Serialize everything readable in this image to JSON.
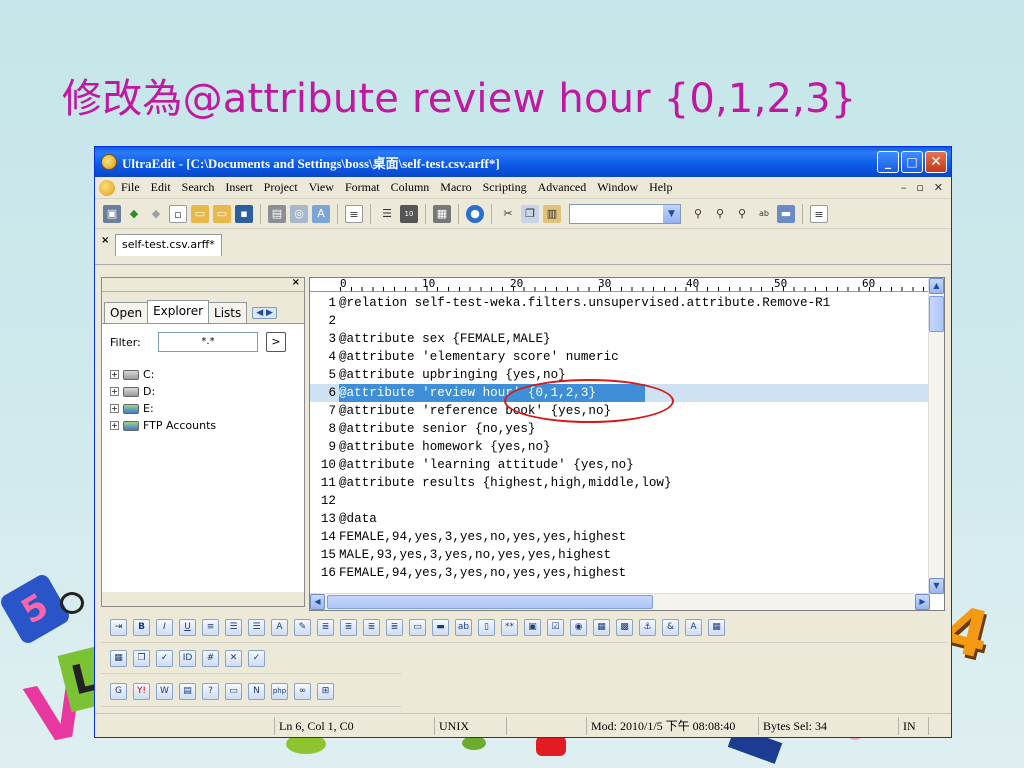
{
  "slide": {
    "title": "修改為@attribute review hour {0,1,2,3}"
  },
  "window": {
    "title": "UltraEdit - [C:\\Documents and Settings\\boss\\桌面\\self-test.csv.arff*]",
    "buttons": {
      "minimize": "_",
      "maximize": "□",
      "close": "✕"
    }
  },
  "menu": {
    "items": [
      "File",
      "Edit",
      "Search",
      "Insert",
      "Project",
      "View",
      "Format",
      "Column",
      "Macro",
      "Scripting",
      "Advanced",
      "Window",
      "Help"
    ],
    "right": [
      "–",
      "▫",
      "✕"
    ]
  },
  "toolbar": {
    "combo_value": ""
  },
  "file_tab": {
    "label": "self-test.csv.arff*"
  },
  "left_pane": {
    "tabs": [
      "Open",
      "Explorer",
      "Lists"
    ],
    "active_tab": "Explorer",
    "filter_label": "Filter:",
    "filter_value": "*.*",
    "filter_button": ">",
    "tree": [
      "C:",
      "D:",
      "E:",
      "FTP Accounts"
    ]
  },
  "editor": {
    "ruler": [
      "0",
      "10",
      "20",
      "30",
      "40",
      "50",
      "60"
    ],
    "lines": [
      {
        "n": "1",
        "text": "@relation self-test-weka.filters.unsupervised.attribute.Remove-R1"
      },
      {
        "n": "2",
        "text": ""
      },
      {
        "n": "3",
        "text": "@attribute sex {FEMALE,MALE}"
      },
      {
        "n": "4",
        "text": "@attribute 'elementary score' numeric"
      },
      {
        "n": "5",
        "text": "@attribute upbringing {yes,no}"
      },
      {
        "n": "6",
        "text": "@attribute 'review hour' {0,1,2,3}"
      },
      {
        "n": "7",
        "text": "@attribute 'reference book' {yes,no}"
      },
      {
        "n": "8",
        "text": "@attribute senior {no,yes}"
      },
      {
        "n": "9",
        "text": "@attribute homework {yes,no}"
      },
      {
        "n": "10",
        "text": "@attribute 'learning attitude' {yes,no}"
      },
      {
        "n": "11",
        "text": "@attribute results {highest,high,middle,low}"
      },
      {
        "n": "12",
        "text": ""
      },
      {
        "n": "13",
        "text": "@data"
      },
      {
        "n": "14",
        "text": "FEMALE,94,yes,3,yes,no,yes,yes,highest"
      },
      {
        "n": "15",
        "text": "MALE,93,yes,3,yes,no,yes,yes,highest"
      },
      {
        "n": "16",
        "text": "FEMALE,94,yes,3,yes,no,yes,yes,highest"
      }
    ],
    "highlighted_line": "6"
  },
  "status": {
    "position": "Ln 6, Col 1, C0",
    "format": "UNIX",
    "modified": "Mod: 2010/1/5 下午 08:08:40",
    "bytes": "Bytes Sel: 34",
    "mode": "IN"
  },
  "colors": {
    "title": "#c0189f",
    "titlebar": "#0a5ae8",
    "highlight": "#3f8fd8",
    "annotation": "#d61a1a"
  }
}
